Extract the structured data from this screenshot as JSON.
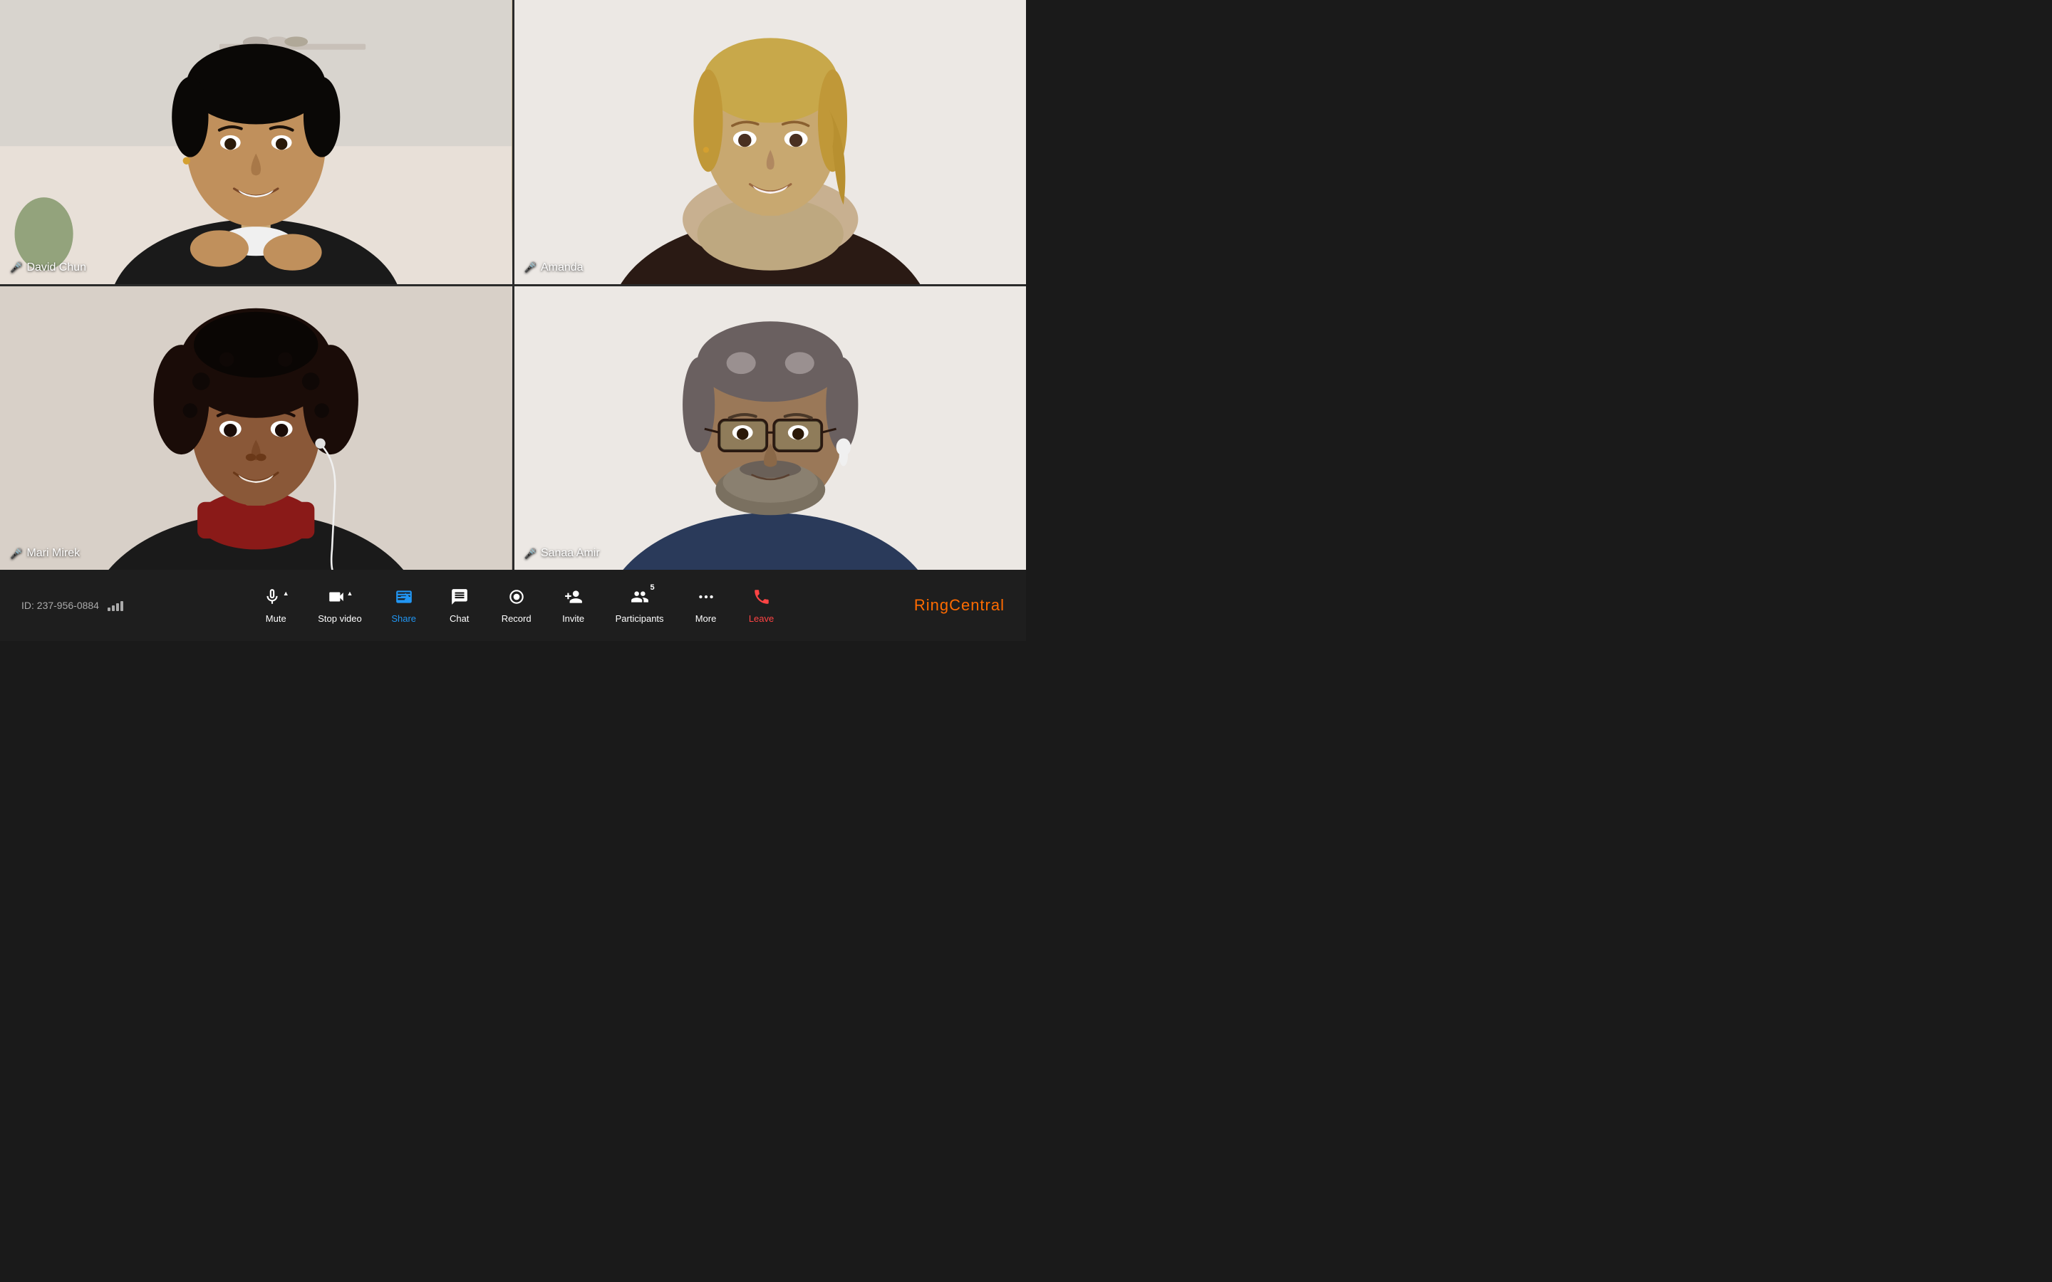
{
  "meeting": {
    "id": "ID: 237-956-0884",
    "participants": [
      {
        "name": "David Chun",
        "muted": false,
        "active_speaker": true,
        "position": "top-left"
      },
      {
        "name": "Amanda",
        "muted": true,
        "active_speaker": false,
        "position": "top-right"
      },
      {
        "name": "Mari Mirek",
        "muted": false,
        "active_speaker": false,
        "position": "bottom-left"
      },
      {
        "name": "Sanaa Amir",
        "muted": false,
        "active_speaker": false,
        "position": "bottom-right"
      }
    ],
    "participant_count": 5
  },
  "toolbar": {
    "buttons": [
      {
        "id": "mute",
        "label": "Mute",
        "has_arrow": true
      },
      {
        "id": "stop-video",
        "label": "Stop video",
        "has_arrow": true
      },
      {
        "id": "share",
        "label": "Share",
        "has_arrow": false,
        "highlighted": true
      },
      {
        "id": "chat",
        "label": "Chat",
        "has_arrow": false
      },
      {
        "id": "record",
        "label": "Record",
        "has_arrow": false
      },
      {
        "id": "invite",
        "label": "Invite",
        "has_arrow": false
      },
      {
        "id": "participants",
        "label": "Participants",
        "has_arrow": false,
        "badge": "5"
      },
      {
        "id": "more",
        "label": "More",
        "has_arrow": false
      },
      {
        "id": "leave",
        "label": "Leave",
        "has_arrow": false
      }
    ]
  },
  "brand": {
    "name": "RingCentral",
    "ring_part": "Ring",
    "central_part": "Central"
  }
}
